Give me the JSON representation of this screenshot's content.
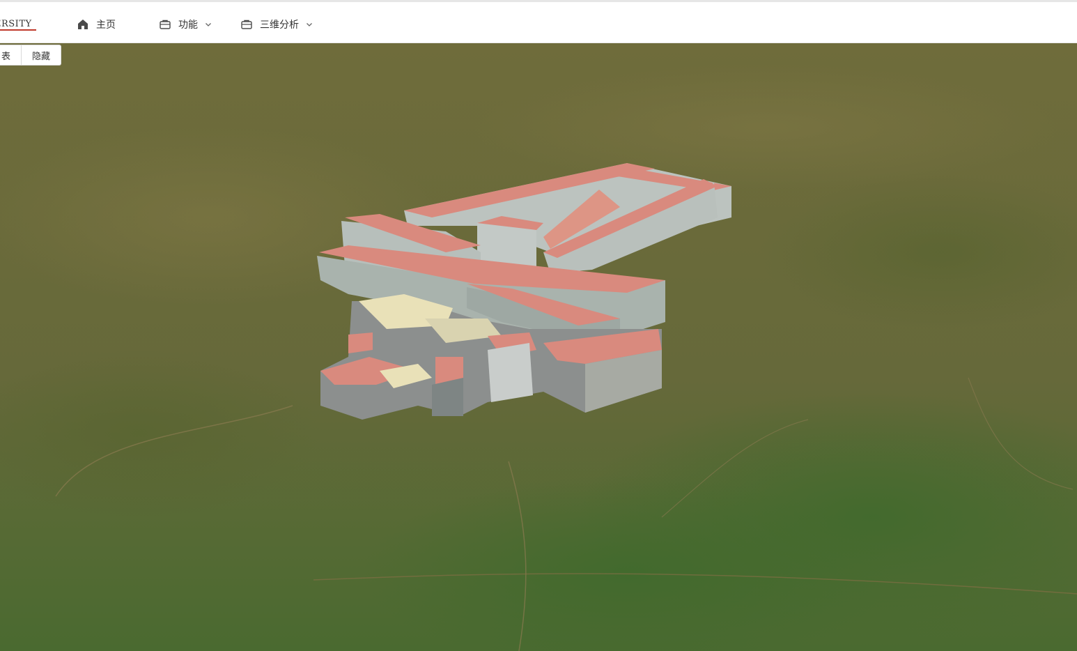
{
  "header": {
    "logo_text": "ERSITY",
    "nav": [
      {
        "label": "主页",
        "icon": "home-icon",
        "has_dropdown": false
      },
      {
        "label": "功能",
        "icon": "briefcase-icon",
        "has_dropdown": true
      },
      {
        "label": "三维分析",
        "icon": "briefcase-icon",
        "has_dropdown": true
      }
    ]
  },
  "toolbar": {
    "show_label": "表",
    "hide_label": "隐藏"
  },
  "scene": {
    "terrain_colors": [
      "#6f6c3b",
      "#5f6a35",
      "#486a2e"
    ],
    "roof_color": "#d98a7e",
    "wall_color": "#b9c0bd"
  }
}
